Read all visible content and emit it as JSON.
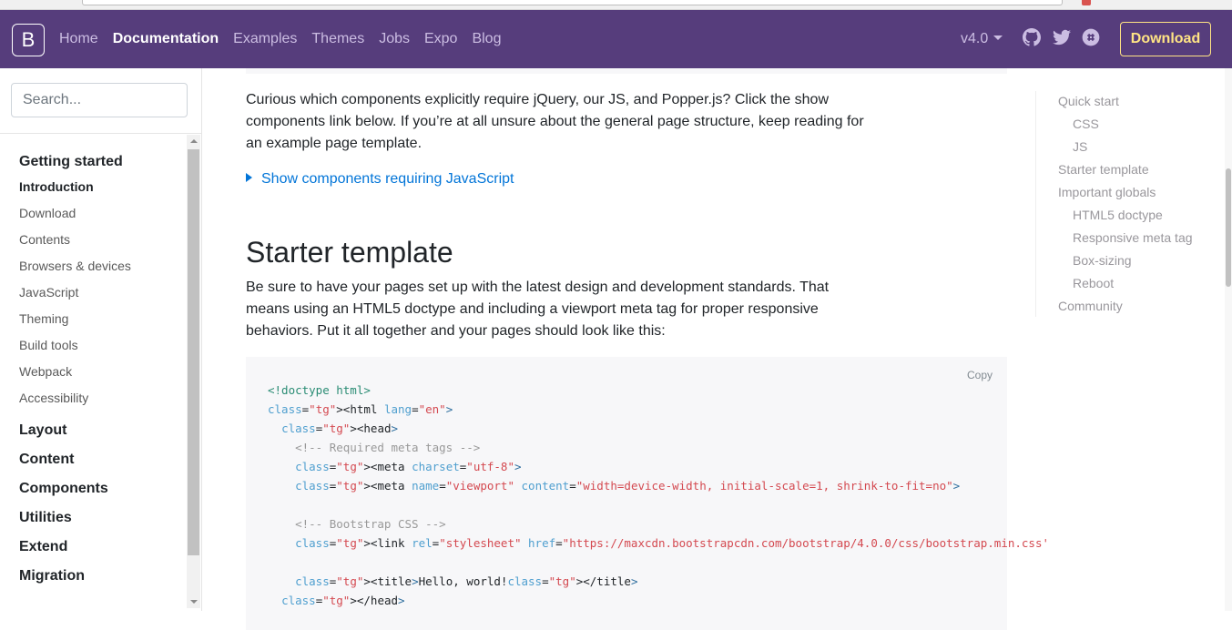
{
  "navbar": {
    "brand": "B",
    "links": [
      {
        "label": "Home",
        "active": false
      },
      {
        "label": "Documentation",
        "active": true
      },
      {
        "label": "Examples",
        "active": false
      },
      {
        "label": "Themes",
        "active": false
      },
      {
        "label": "Jobs",
        "active": false
      },
      {
        "label": "Expo",
        "active": false
      },
      {
        "label": "Blog",
        "active": false
      }
    ],
    "version": "v4.0",
    "download": "Download",
    "icons": [
      "github-icon",
      "twitter-icon",
      "slack-icon"
    ]
  },
  "sidebar": {
    "search_placeholder": "Search...",
    "groups": [
      {
        "title": "Getting started",
        "items": [
          "Introduction",
          "Download",
          "Contents",
          "Browsers & devices",
          "JavaScript",
          "Theming",
          "Build tools",
          "Webpack",
          "Accessibility"
        ],
        "active_item": "Introduction"
      },
      {
        "title": "Layout"
      },
      {
        "title": "Content"
      },
      {
        "title": "Components"
      },
      {
        "title": "Utilities"
      },
      {
        "title": "Extend"
      },
      {
        "title": "Migration"
      }
    ]
  },
  "main": {
    "intro_paragraph": "Curious which components explicitly require jQuery, our JS, and Popper.js? Click the show components link below. If you’re at all unsure about the general page structure, keep reading for an example page template.",
    "details_label": "Show components requiring JavaScript",
    "heading": "Starter template",
    "starter_paragraph": "Be sure to have your pages set up with the latest design and development standards. That means using an HTML5 doctype and including a viewport meta tag for proper responsive behaviors. Put it all together and your pages should look like this:",
    "copy_label": "Copy",
    "code_lines": [
      "<!doctype html>",
      "<html lang=\"en\">",
      "  <head>",
      "    <!-- Required meta tags -->",
      "    <meta charset=\"utf-8\">",
      "    <meta name=\"viewport\" content=\"width=device-width, initial-scale=1, shrink-to-fit=no\">",
      "",
      "    <!-- Bootstrap CSS -->",
      "    <link rel=\"stylesheet\" href=\"https://maxcdn.bootstrapcdn.com/bootstrap/4.0.0/css/bootstrap.min.css'",
      "",
      "    <title>Hello, world!</title>",
      "  </head>"
    ]
  },
  "toc": {
    "items": [
      {
        "label": "Quick start",
        "level": 1
      },
      {
        "label": "CSS",
        "level": 2
      },
      {
        "label": "JS",
        "level": 2
      },
      {
        "label": "Starter template",
        "level": 1
      },
      {
        "label": "Important globals",
        "level": 1
      },
      {
        "label": "HTML5 doctype",
        "level": 2
      },
      {
        "label": "Responsive meta tag",
        "level": 2
      },
      {
        "label": "Box-sizing",
        "level": 2
      },
      {
        "label": "Reboot",
        "level": 2
      },
      {
        "label": "Community",
        "level": 1
      }
    ]
  },
  "colors": {
    "navbar_bg": "#563d7c",
    "nav_link": "#cbbde2",
    "download_accent": "#ffe484",
    "link_blue": "#0275d8",
    "code_bg": "#f7f7f9"
  }
}
